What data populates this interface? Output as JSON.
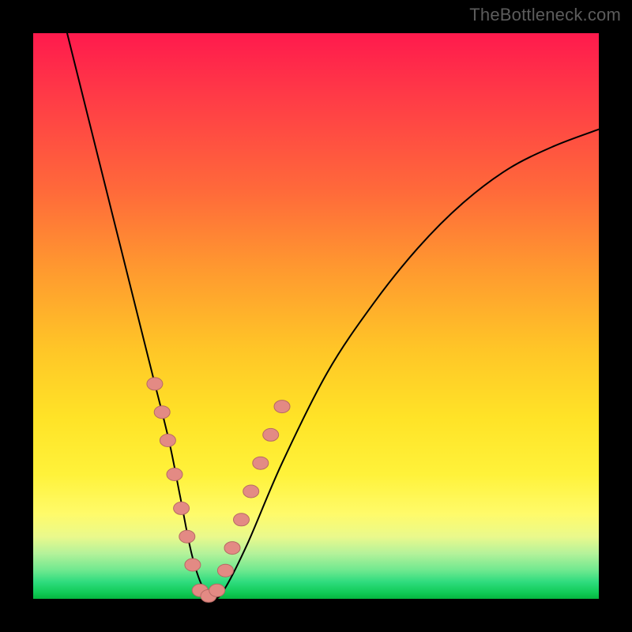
{
  "watermark": {
    "text": "TheBottleneck.com"
  },
  "colors": {
    "background": "#000000",
    "curve_stroke": "#000000",
    "dot_fill": "#e38a84",
    "dot_stroke": "#b66a64"
  },
  "chart_data": {
    "type": "line",
    "title": "",
    "xlabel": "",
    "ylabel": "",
    "xlim": [
      0,
      100
    ],
    "ylim": [
      0,
      100
    ],
    "series": [
      {
        "name": "bottleneck-curve",
        "x": [
          6,
          10,
          14,
          18,
          21,
          24,
          26,
          28,
          30,
          32,
          34,
          38,
          44,
          52,
          60,
          68,
          76,
          84,
          92,
          100
        ],
        "y": [
          100,
          84,
          68,
          52,
          40,
          28,
          18,
          8,
          2,
          0,
          2,
          10,
          24,
          40,
          52,
          62,
          70,
          76,
          80,
          83
        ]
      }
    ],
    "markers": {
      "name": "highlight-dots",
      "points": [
        {
          "x": 21.5,
          "y": 38
        },
        {
          "x": 22.8,
          "y": 33
        },
        {
          "x": 23.8,
          "y": 28
        },
        {
          "x": 25.0,
          "y": 22
        },
        {
          "x": 26.2,
          "y": 16
        },
        {
          "x": 27.2,
          "y": 11
        },
        {
          "x": 28.2,
          "y": 6
        },
        {
          "x": 29.5,
          "y": 1.5
        },
        {
          "x": 31.0,
          "y": 0.5
        },
        {
          "x": 32.5,
          "y": 1.5
        },
        {
          "x": 34.0,
          "y": 5
        },
        {
          "x": 35.2,
          "y": 9
        },
        {
          "x": 36.8,
          "y": 14
        },
        {
          "x": 38.5,
          "y": 19
        },
        {
          "x": 40.2,
          "y": 24
        },
        {
          "x": 42.0,
          "y": 29
        },
        {
          "x": 44.0,
          "y": 34
        }
      ]
    }
  }
}
